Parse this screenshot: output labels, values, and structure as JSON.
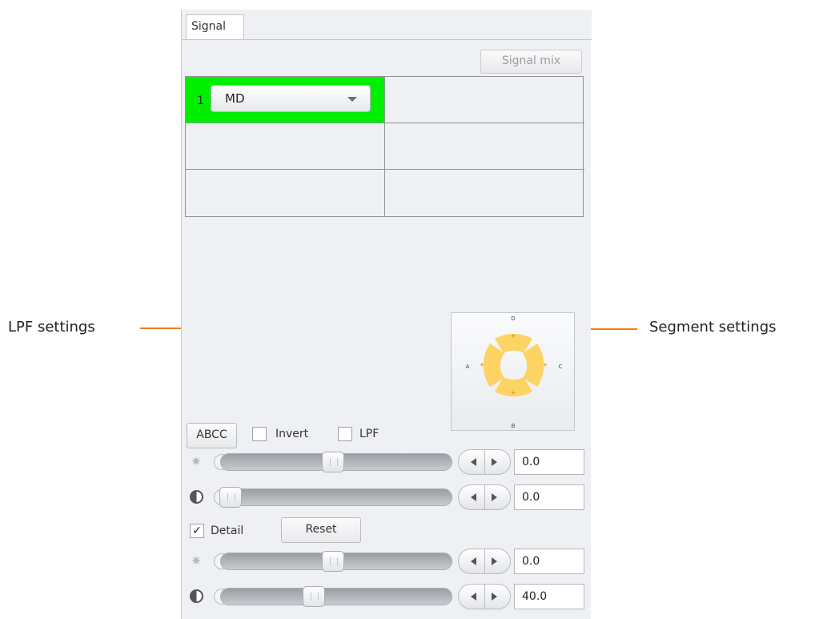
{
  "tab": {
    "label": "Signal"
  },
  "toolbar": {
    "signal_mix": "Signal mix"
  },
  "grid": {
    "cell1": {
      "number": "1",
      "signal": "MD"
    }
  },
  "segment": {
    "labels": {
      "top": "D",
      "bottom": "B",
      "left": "A",
      "right": "C"
    },
    "color": "#fdd464"
  },
  "options": {
    "abcc": "ABCC",
    "invert": "Invert",
    "invert_checked": false,
    "lpf": "LPF",
    "lpf_checked": false
  },
  "sliders": {
    "brightness1": {
      "value": "0.0"
    },
    "contrast1": {
      "value": "0.0"
    },
    "brightness2": {
      "value": "0.0"
    },
    "contrast2": {
      "value": "40.0"
    }
  },
  "detail": {
    "label": "Detail",
    "checked": true,
    "check_glyph": "✓",
    "reset": "Reset"
  },
  "callouts": {
    "lpf": "LPF settings",
    "segment": "Segment settings"
  },
  "colors": {
    "active_cell": "#00ee00",
    "callout": "#f07d14"
  }
}
